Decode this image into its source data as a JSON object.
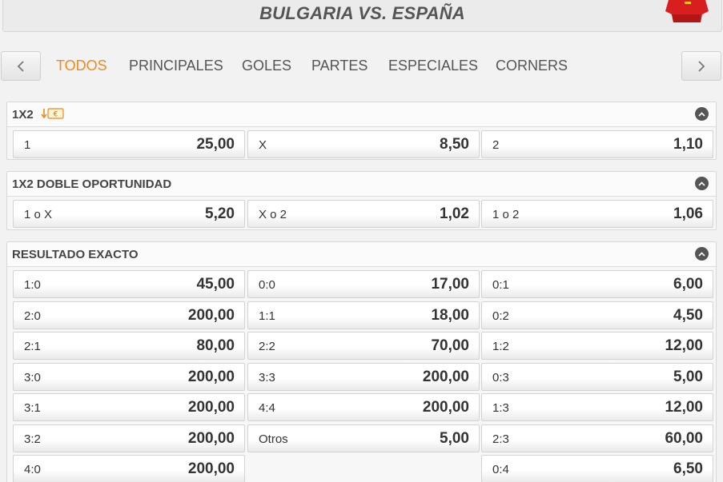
{
  "header": {
    "title": "BULGARIA VS. ESPAÑA"
  },
  "nav": {
    "tabs": [
      {
        "label": "TODOS",
        "active": true
      },
      {
        "label": "PRINCIPALES"
      },
      {
        "label": "GOLES"
      },
      {
        "label": "PARTES"
      },
      {
        "label": "ESPECIALES"
      },
      {
        "label": "CORNERS"
      }
    ]
  },
  "colors": {
    "accent": "#f08a1c",
    "text": "#333333",
    "background": "#f2f2f2"
  },
  "markets": {
    "m1x2": {
      "title": "1X2",
      "odds": [
        {
          "label": "1",
          "value": "25,00"
        },
        {
          "label": "X",
          "value": "8,50"
        },
        {
          "label": "2",
          "value": "1,10"
        }
      ]
    },
    "doble": {
      "title": "1X2 DOBLE OPORTUNIDAD",
      "odds": [
        {
          "label": "1 o X",
          "value": "5,20"
        },
        {
          "label": "X o 2",
          "value": "1,02"
        },
        {
          "label": "1 o 2",
          "value": "1,06"
        }
      ]
    },
    "exacto": {
      "title": "RESULTADO EXACTO",
      "col1": [
        {
          "label": "1:0",
          "value": "45,00"
        },
        {
          "label": "2:0",
          "value": "200,00"
        },
        {
          "label": "2:1",
          "value": "80,00"
        },
        {
          "label": "3:0",
          "value": "200,00"
        },
        {
          "label": "3:1",
          "value": "200,00"
        },
        {
          "label": "3:2",
          "value": "200,00"
        },
        {
          "label": "4:0",
          "value": "200,00"
        }
      ],
      "col2": [
        {
          "label": "0:0",
          "value": "17,00"
        },
        {
          "label": "1:1",
          "value": "18,00"
        },
        {
          "label": "2:2",
          "value": "70,00"
        },
        {
          "label": "3:3",
          "value": "200,00"
        },
        {
          "label": "4:4",
          "value": "200,00"
        },
        {
          "label": "Otros",
          "value": "5,00"
        }
      ],
      "col3": [
        {
          "label": "0:1",
          "value": "6,00"
        },
        {
          "label": "0:2",
          "value": "4,50"
        },
        {
          "label": "1:2",
          "value": "12,00"
        },
        {
          "label": "0:3",
          "value": "5,00"
        },
        {
          "label": "1:3",
          "value": "12,00"
        },
        {
          "label": "2:3",
          "value": "60,00"
        },
        {
          "label": "0:4",
          "value": "6,50"
        }
      ]
    }
  }
}
